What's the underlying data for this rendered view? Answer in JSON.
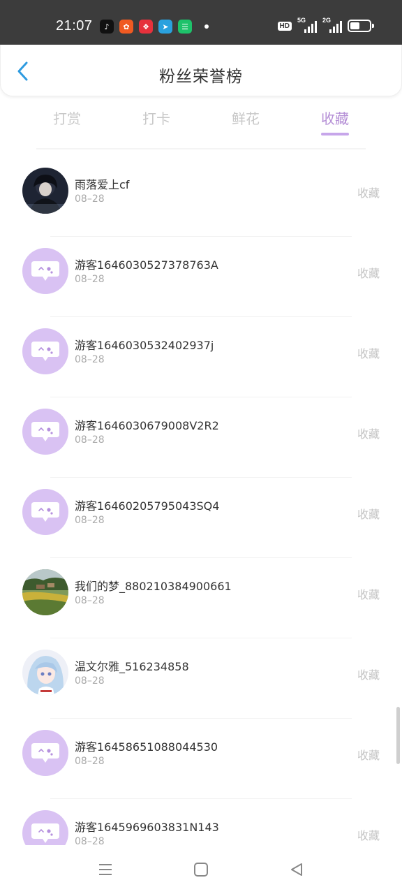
{
  "status_bar": {
    "time": "21:07",
    "hd_label": "HD",
    "signal_1_label": "5G",
    "signal_2_label": "2G",
    "app_icons": [
      {
        "name": "tiktok-icon",
        "color": "#111111",
        "glyph": "♪"
      },
      {
        "name": "orange-app-icon",
        "color": "#f05a22",
        "glyph": "✿"
      },
      {
        "name": "red-app-icon",
        "color": "#e6313c",
        "glyph": "❖"
      },
      {
        "name": "telegram-icon",
        "color": "#2aa1de",
        "glyph": "➤"
      },
      {
        "name": "green-app-icon",
        "color": "#1ec26a",
        "glyph": "☰"
      }
    ]
  },
  "header": {
    "title": "粉丝荣誉榜",
    "back_icon": "chevron-left-icon",
    "accent": "#2e9be0"
  },
  "tabs": [
    {
      "label": "打赏",
      "active": false
    },
    {
      "label": "打卡",
      "active": false
    },
    {
      "label": "鲜花",
      "active": false
    },
    {
      "label": "收藏",
      "active": true
    }
  ],
  "tab_active_color": "#b58fd6",
  "list": [
    {
      "name": "雨落爱上cf",
      "date": "08–28",
      "tag": "收藏",
      "avatar": "photo-dark"
    },
    {
      "name": "游客1646030527378763A",
      "date": "08–28",
      "tag": "收藏",
      "avatar": "default"
    },
    {
      "name": "游客1646030532402937j",
      "date": "08–28",
      "tag": "收藏",
      "avatar": "default"
    },
    {
      "name": "游客1646030679008V2R2",
      "date": "08–28",
      "tag": "收藏",
      "avatar": "default"
    },
    {
      "name": "游客16460205795043SQ4",
      "date": "08–28",
      "tag": "收藏",
      "avatar": "default"
    },
    {
      "name": "我们的梦_880210384900661",
      "date": "08–28",
      "tag": "收藏",
      "avatar": "photo-landscape"
    },
    {
      "name": "温文尔雅_516234858",
      "date": "08–28",
      "tag": "收藏",
      "avatar": "photo-anime"
    },
    {
      "name": "游客16458651088044530",
      "date": "08–28",
      "tag": "收藏",
      "avatar": "default"
    },
    {
      "name": "游客1645969603831N143",
      "date": "08–28",
      "tag": "收藏",
      "avatar": "default"
    }
  ],
  "nav_bar": {
    "menu_icon": "menu-icon",
    "home_icon": "home-square-icon",
    "back_icon": "back-triangle-icon"
  }
}
